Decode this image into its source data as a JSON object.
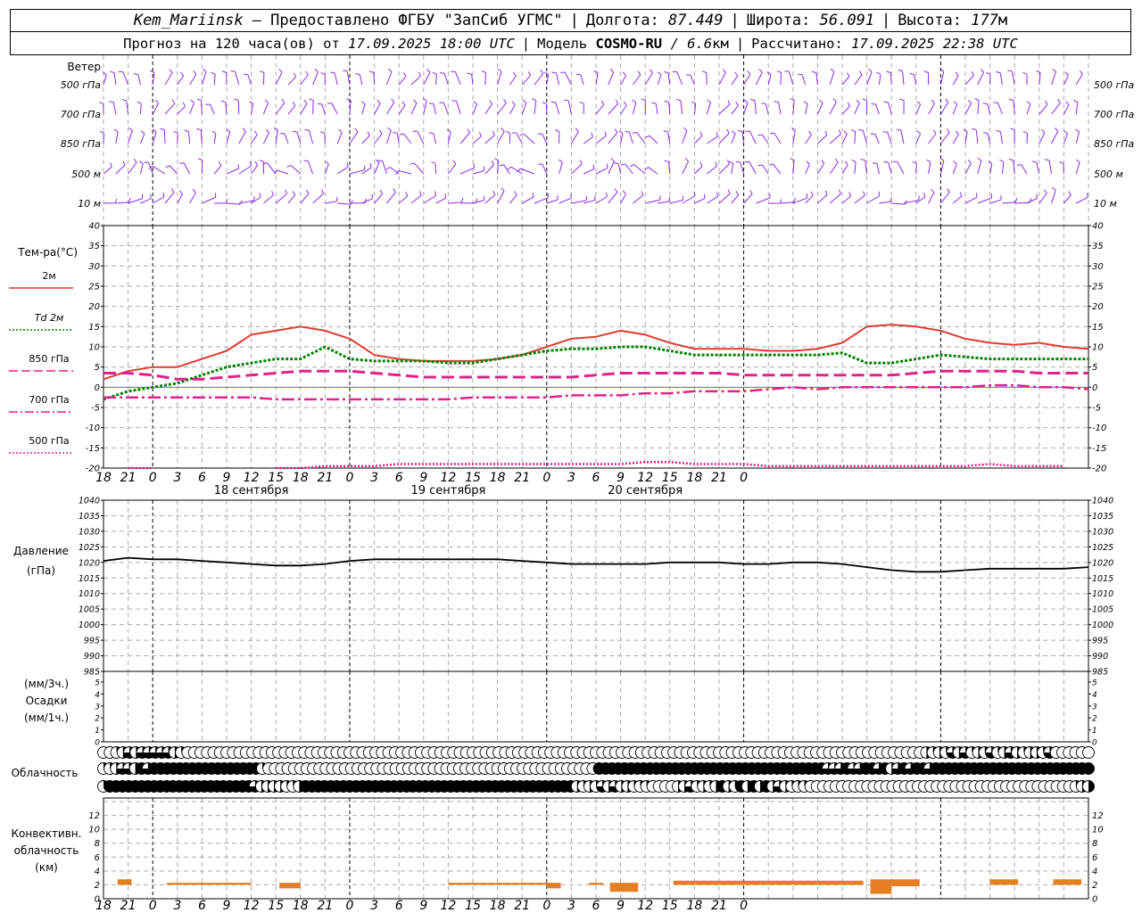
{
  "header": {
    "station": "Kem_Mariinsk",
    "provider": "– Предоставлено ФГБУ \"ЗапСиб УГМС\"",
    "lon_label": "Долгота:",
    "lon_value": "87.449",
    "lat_label": "Широта:",
    "lat_value": "56.091",
    "alt_label": "Высота:",
    "alt_value": "177",
    "alt_unit": "м",
    "forecast_prefix": "Прогноз на 120 часа(ов) от",
    "forecast_start": "17.09.2025 18:00 UTC",
    "model_label": "Модель",
    "model_name": "COSMO-RU",
    "model_res": "/ 6.6",
    "model_res_unit": "км",
    "calc_label": "Рассчитано:",
    "calc_time": "17.09.2025 22:38 UTC"
  },
  "hours": [
    "18",
    "21",
    "0",
    "3",
    "6",
    "9",
    "12",
    "15",
    "18",
    "21",
    "0",
    "3",
    "6",
    "9",
    "12",
    "15",
    "18",
    "21",
    "0",
    "3",
    "6",
    "9",
    "12",
    "15",
    "18",
    "21",
    "0"
  ],
  "day_labels": [
    "18 сентября",
    "19 сентября",
    "20 сентября"
  ],
  "wind_panel": {
    "title": "Ветер",
    "levels": [
      "500 гПа",
      "700 гПа",
      "850 гПа",
      "500 м",
      "10 м"
    ],
    "color": "#8a2be2"
  },
  "chart_data": [
    {
      "id": "temperature",
      "type": "line",
      "title": "Тем-ра(°C)",
      "ylim": [
        -20,
        40
      ],
      "yticks": [
        "40",
        "35",
        "30",
        "25",
        "20",
        "15",
        "10",
        "5",
        "0",
        "-5",
        "-10",
        "-15",
        "-20"
      ],
      "x_hours_from_start": [
        0,
        3,
        6,
        9,
        12,
        15,
        18,
        21,
        24,
        27,
        30,
        33,
        36,
        39,
        42,
        45,
        48,
        51,
        54,
        57,
        60,
        63,
        66,
        69,
        72,
        75,
        78,
        81,
        84,
        87,
        90,
        93,
        96,
        99,
        102,
        105,
        108,
        111,
        114,
        117,
        120
      ],
      "series": [
        {
          "name": "2м",
          "color": "#e03c31",
          "style": "solid",
          "values": [
            2,
            4,
            5,
            5,
            7,
            9,
            13,
            14,
            15,
            14,
            12,
            8,
            7,
            6.5,
            6.5,
            6.5,
            7,
            8,
            10,
            12,
            12.5,
            14,
            13,
            11,
            9.5,
            9.5,
            9.5,
            9,
            9,
            9.5,
            11,
            15,
            15.5,
            15,
            14,
            12,
            11,
            10.5,
            11,
            10,
            9.5
          ]
        },
        {
          "name": "Td 2м",
          "color": "#008000",
          "style": "dotted",
          "values": [
            -3,
            -1,
            0,
            1,
            3,
            5,
            6,
            7,
            7,
            10,
            7,
            6.5,
            6.5,
            6.5,
            6,
            6,
            7,
            8,
            9,
            9.5,
            9.5,
            10,
            10,
            9,
            8,
            8,
            8,
            8,
            8,
            8,
            8.5,
            6,
            6,
            7,
            8,
            7.5,
            7,
            7,
            7,
            7,
            7
          ]
        },
        {
          "name": "850 гПа",
          "color": "#e0218a",
          "style": "dash",
          "values": [
            3.5,
            3.5,
            3,
            2,
            2,
            2.5,
            3,
            3.5,
            4,
            4,
            4,
            3.5,
            3,
            2.5,
            2.5,
            2.5,
            2.5,
            2.5,
            2.5,
            2.5,
            3,
            3.5,
            3.5,
            3.5,
            3.5,
            3.5,
            3,
            3,
            3,
            3,
            3,
            3,
            3,
            3.5,
            4,
            4,
            4,
            4,
            3.5,
            3.5,
            3.5
          ]
        },
        {
          "name": "700 гПа",
          "color": "#e0218a",
          "style": "dashdot",
          "values": [
            -2.5,
            -2.5,
            -2.5,
            -2.5,
            -2.5,
            -2.5,
            -2.5,
            -3,
            -3,
            -3,
            -3,
            -3,
            -3,
            -3,
            -3,
            -2.5,
            -2.5,
            -2.5,
            -2.5,
            -2,
            -2,
            -2,
            -1.5,
            -1.5,
            -1,
            -1,
            -1,
            -0.5,
            0,
            -0.5,
            0,
            0,
            0,
            0,
            0,
            0,
            0.5,
            0.5,
            0,
            0,
            -0.5
          ]
        },
        {
          "name": "500 гПа",
          "color": "#e0218a",
          "style": "dotted-fine",
          "values": [
            null,
            -20,
            -20,
            null,
            null,
            null,
            null,
            -20,
            -20,
            -19.5,
            -19.5,
            -19.5,
            -19,
            -19,
            -19,
            -19,
            -19,
            -19,
            -19,
            -19,
            -19,
            -19,
            -18.5,
            -18.5,
            -19,
            -19,
            -19,
            -19.5,
            -19.5,
            -19.5,
            -19.5,
            -19.5,
            -19.5,
            -19.5,
            -19.5,
            -19.5,
            -19,
            -19.5,
            -19.5,
            -19.5,
            null
          ]
        }
      ]
    },
    {
      "id": "pressure",
      "type": "line",
      "title": "Давление",
      "unit_label": "(гПа)",
      "ylim": [
        985,
        1040
      ],
      "yticks": [
        "1040",
        "1035",
        "1030",
        "1025",
        "1020",
        "1015",
        "1010",
        "1005",
        "1000",
        "995",
        "990",
        "985"
      ],
      "series": [
        {
          "name": "",
          "color": "#000000",
          "values": [
            1020.5,
            1021.5,
            1021,
            1021,
            1020.5,
            1020,
            1019.5,
            1019,
            1019,
            1019.5,
            1020.5,
            1021,
            1021,
            1021,
            1021,
            1021,
            1021,
            1020.5,
            1020,
            1019.5,
            1019.5,
            1019.5,
            1019.5,
            1020,
            1020,
            1020,
            1019.5,
            1019.5,
            1020,
            1020,
            1019.5,
            1018.5,
            1017.5,
            1017,
            1017,
            1017.5,
            1018,
            1018,
            1018,
            1018,
            1018.5
          ]
        }
      ]
    },
    {
      "id": "precipitation",
      "type": "bar",
      "title": "Осадки",
      "unit_top": "(мм/3ч.)",
      "unit_bottom": "(мм/1ч.)",
      "ylim": [
        0,
        5
      ],
      "yticks": [
        "5",
        "4",
        "3",
        "2",
        "1",
        "0"
      ],
      "values": []
    },
    {
      "id": "convective",
      "type": "bar",
      "title_lines": [
        "Конвективн.",
        "облачность",
        "(км)"
      ],
      "ylim": [
        0,
        14
      ],
      "yticks": [
        "12",
        "10",
        "8",
        "6",
        "4",
        "2",
        "0"
      ],
      "color": "#e67e22",
      "bars": [
        {
          "x": [
            2,
            4
          ],
          "y": [
            2,
            2.8
          ]
        },
        {
          "x": [
            9,
            21
          ],
          "y": [
            2,
            2.3
          ]
        },
        {
          "x": [
            25,
            28
          ],
          "y": [
            1.5,
            2.3
          ]
        },
        {
          "x": [
            49,
            63
          ],
          "y": [
            2,
            2.3
          ]
        },
        {
          "x": [
            63,
            65
          ],
          "y": [
            1.5,
            2.3
          ]
        },
        {
          "x": [
            69,
            71
          ],
          "y": [
            2,
            2.3
          ]
        },
        {
          "x": [
            72,
            76
          ],
          "y": [
            1,
            2.3
          ]
        },
        {
          "x": [
            81,
            105
          ],
          "y": [
            2,
            2.6
          ]
        },
        {
          "x": [
            105,
            108
          ],
          "y": [
            2,
            2.6
          ]
        },
        {
          "x": [
            109,
            112
          ],
          "y": [
            0.7,
            2.8
          ]
        },
        {
          "x": [
            112,
            116
          ],
          "y": [
            1.8,
            2.8
          ]
        },
        {
          "x": [
            126,
            130
          ],
          "y": [
            2,
            2.8
          ]
        },
        {
          "x": [
            135,
            139
          ],
          "y": [
            2,
            2.8
          ]
        }
      ]
    }
  ],
  "temperature_legend": [
    {
      "label": "2м",
      "color": "#e03c31",
      "style": "solid"
    },
    {
      "label": "Td 2м",
      "color": "#008000",
      "style": "dotted"
    },
    {
      "label": "850 гПа",
      "color": "#e0218a",
      "style": "dash"
    },
    {
      "label": "700 гПа",
      "color": "#e0218a",
      "style": "dashdot"
    },
    {
      "label": "500 гПа",
      "color": "#e0218a",
      "style": "dotted-fine"
    }
  ],
  "cloud_panel": {
    "title": "Облачность",
    "rows": [
      [
        0,
        0,
        25,
        50,
        75,
        50,
        75,
        75,
        75,
        75,
        75,
        50,
        25,
        0,
        0,
        0,
        0,
        0,
        0,
        0,
        0,
        0,
        0,
        0,
        0,
        0,
        0,
        0,
        0,
        0,
        0,
        0,
        0,
        0,
        0,
        0,
        0,
        0,
        0,
        0,
        0,
        0,
        0,
        0,
        0,
        0,
        0,
        0,
        0,
        0,
        0,
        0,
        0,
        0,
        0,
        0,
        0,
        0,
        0,
        0,
        0,
        0,
        0,
        0,
        0,
        0,
        0,
        0,
        0,
        0,
        0,
        0,
        0,
        0,
        0,
        0,
        0,
        0,
        0,
        0,
        0,
        0,
        0,
        0,
        0,
        0,
        0,
        0,
        0,
        0,
        0,
        0,
        0,
        0,
        0,
        0,
        0,
        0,
        0,
        0,
        0,
        0,
        0,
        0,
        0,
        0,
        0,
        0,
        0,
        0,
        0,
        0,
        0,
        0,
        0,
        0,
        0,
        0,
        0,
        0,
        0,
        0,
        0,
        0,
        0,
        0,
        0,
        50,
        25,
        50,
        25,
        75,
        50,
        75,
        25,
        50,
        25,
        75,
        25,
        50,
        75,
        50,
        25,
        50,
        50,
        25,
        75,
        0,
        0,
        0,
        0,
        0,
        0
      ],
      [
        25,
        25,
        50,
        75,
        75,
        50,
        100,
        75,
        100,
        100,
        100,
        100,
        100,
        100,
        100,
        100,
        100,
        100,
        100,
        100,
        100,
        100,
        100,
        100,
        100,
        25,
        0,
        0,
        0,
        0,
        0,
        0,
        0,
        0,
        0,
        0,
        0,
        0,
        0,
        0,
        0,
        0,
        0,
        0,
        0,
        0,
        0,
        0,
        0,
        0,
        0,
        0,
        0,
        0,
        0,
        0,
        0,
        0,
        0,
        0,
        0,
        0,
        0,
        0,
        0,
        0,
        0,
        0,
        0,
        0,
        0,
        0,
        0,
        0,
        0,
        0,
        0,
        0,
        100,
        100,
        100,
        100,
        100,
        100,
        100,
        100,
        100,
        100,
        100,
        100,
        100,
        100,
        100,
        100,
        100,
        100,
        100,
        100,
        100,
        100,
        100,
        100,
        100,
        100,
        100,
        100,
        100,
        100,
        100,
        100,
        100,
        100,
        100,
        100,
        75,
        75,
        75,
        100,
        75,
        75,
        100,
        100,
        75,
        100,
        50,
        75,
        100,
        75,
        100,
        100,
        75,
        100,
        100,
        100,
        100,
        100,
        100,
        100,
        100,
        100,
        100,
        100,
        100,
        100,
        100,
        100,
        100,
        100,
        100,
        100,
        100,
        100,
        100,
        100,
        100,
        100
      ],
      [
        25,
        100,
        100,
        100,
        100,
        100,
        100,
        100,
        100,
        100,
        100,
        100,
        100,
        100,
        100,
        100,
        100,
        100,
        100,
        100,
        100,
        100,
        100,
        100,
        75,
        50,
        50,
        50,
        50,
        25,
        25,
        50,
        100,
        100,
        100,
        100,
        100,
        100,
        100,
        100,
        100,
        100,
        100,
        100,
        100,
        100,
        100,
        100,
        100,
        100,
        100,
        100,
        100,
        100,
        100,
        100,
        100,
        100,
        100,
        100,
        100,
        100,
        100,
        100,
        100,
        100,
        100,
        100,
        100,
        100,
        100,
        100,
        100,
        100,
        100,
        50,
        25,
        50,
        25,
        75,
        50,
        75,
        50,
        50,
        25,
        25,
        25,
        0,
        0,
        0,
        0,
        50,
        50,
        75,
        25,
        50,
        25,
        50,
        100,
        50,
        25,
        100,
        50,
        100,
        50,
        100,
        50,
        75,
        50,
        25,
        25,
        25,
        0,
        0,
        0,
        0,
        0,
        0,
        0,
        0,
        0,
        0,
        0,
        0,
        0,
        0,
        0,
        0,
        0,
        0,
        0,
        0,
        0,
        0,
        0,
        0,
        0,
        0,
        0,
        0,
        0,
        0,
        0,
        0,
        0,
        0,
        0,
        0,
        0,
        0,
        0,
        0,
        0,
        0,
        25,
        50,
        50
      ]
    ]
  }
}
